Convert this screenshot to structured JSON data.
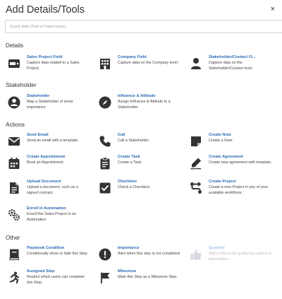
{
  "header": {
    "title": "Add Details/Tools",
    "close": "×"
  },
  "search": {
    "placeholder": "Quick Add (Tool or Field name)"
  },
  "sections": {
    "details": "Details",
    "stakeholder": "Stakeholder",
    "actions": "Actions",
    "other": "Other"
  },
  "items": {
    "sales_project_field": {
      "label": "Sales Project Field",
      "desc": "Capture data related to a Sales Project.",
      "icon": "field-card-icon"
    },
    "company_field": {
      "label": "Company Field",
      "desc": "Capture data on the Company level.",
      "icon": "building-icon"
    },
    "stakeholder_contact_field": {
      "label": "Stakeholder/Contact Fi...",
      "desc": "Capture data on the Stakeholder/Contact level.",
      "icon": "person-icon"
    },
    "stakeholder": {
      "label": "Stakeholder",
      "desc": "Map a Stakeholder of some importance.",
      "icon": "person-circle-icon"
    },
    "influence_attitude": {
      "label": "Influence & Attitude",
      "desc": "Assign Influence & Attitude to a Stakeholder.",
      "icon": "compass-icon"
    },
    "send_email": {
      "label": "Send Email",
      "desc": "Send an email with a template.",
      "icon": "envelope-icon"
    },
    "call": {
      "label": "Call",
      "desc": "Call a Stakeholder.",
      "icon": "phone-icon"
    },
    "create_note": {
      "label": "Create Note",
      "desc": "Create a Note.",
      "icon": "note-icon"
    },
    "create_appointment": {
      "label": "Create Appointment",
      "desc": "Book an Appointment.",
      "icon": "calendar-icon"
    },
    "create_task": {
      "label": "Create Task",
      "desc": "Create a Task.",
      "icon": "clipboard-icon"
    },
    "create_agreement": {
      "label": "Create Agreement",
      "desc": "Create new agreement with template.",
      "icon": "signature-icon"
    },
    "upload_document": {
      "label": "Upload Document",
      "desc": "Upload a document, such as a signed contract.",
      "icon": "document-icon"
    },
    "checkbox": {
      "label": "Checkbox",
      "desc": "Check a Checkbox.",
      "icon": "checkbox-icon"
    },
    "create_project": {
      "label": "Create Project",
      "desc": "Create a new Project in any of your available workflows.",
      "icon": "route-icon"
    },
    "enroll_automation": {
      "label": "Enroll in Automation",
      "desc": "Enroll this Sales Project in an Automation.",
      "icon": "automation-icon"
    },
    "playbook_condition": {
      "label": "Playbook Condition",
      "desc": "Conditionally show or hide this Step.",
      "icon": "book-icon"
    },
    "importance": {
      "label": "Importance",
      "desc": "Alert when this step is not completed.",
      "icon": "alert-icon"
    },
    "qualifier": {
      "label": "Qualifier",
      "desc": "Add a criteria for qualifying a piece of information.",
      "icon": "thumbs-up-icon"
    },
    "assigned_step": {
      "label": "Assigned Step",
      "desc": "Restrict which users can complete this Step.",
      "icon": "runner-icon"
    },
    "milestone": {
      "label": "Milestone",
      "desc": "Mark this Step as a Milestone Step.",
      "icon": "flag-icon"
    }
  },
  "colors": {
    "link": "#2a6bb4",
    "icon": "#333333",
    "disabled": "#aac7e8"
  }
}
